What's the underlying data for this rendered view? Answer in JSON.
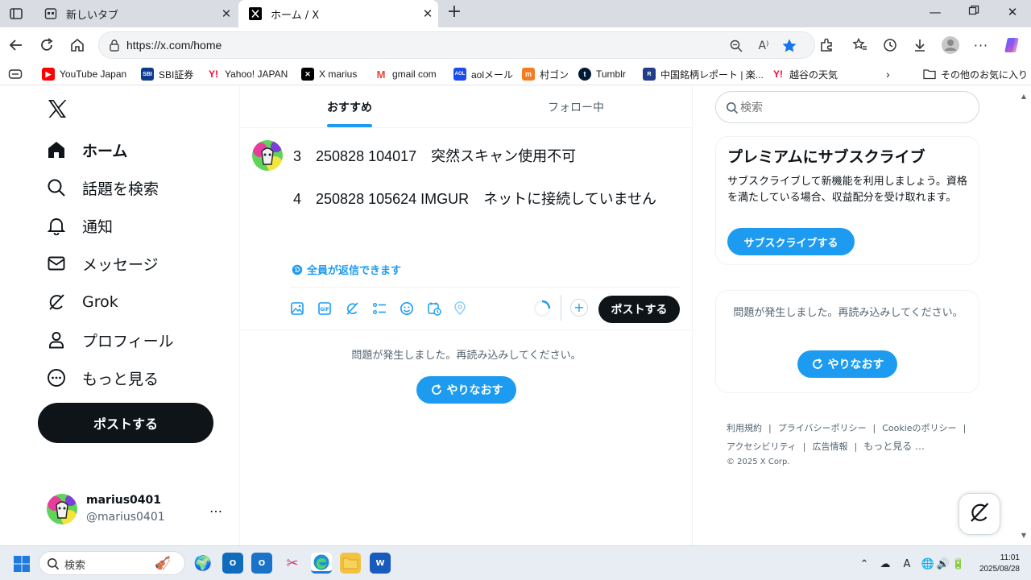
{
  "browser": {
    "tabs": [
      {
        "title": "新しいタブ",
        "icon": "new-tab-page-icon",
        "active": false
      },
      {
        "title": "ホーム / X",
        "icon": "x-logo-icon",
        "active": true
      }
    ],
    "url": "https://x.com/home",
    "bookmarks": [
      {
        "label": "YouTube Japan",
        "icon": "youtube-icon",
        "color": "#ff0000"
      },
      {
        "label": "SBI証券",
        "icon": "sbi-icon",
        "color": "#0b3a8f"
      },
      {
        "label": "Yahoo! JAPAN",
        "icon": "yahoo-icon",
        "color": "#ff0033"
      },
      {
        "label": "X marius",
        "icon": "x-logo-icon",
        "color": "#000000"
      },
      {
        "label": "gmail com",
        "icon": "gmail-icon",
        "color": "#ea4335"
      },
      {
        "label": "aolメール",
        "icon": "aol-icon",
        "color": "#1a4cf0"
      },
      {
        "label": "村ゴン",
        "icon": "murago-icon",
        "color": "#f47b20"
      },
      {
        "label": "Tumblr",
        "icon": "tumblr-icon",
        "color": "#001935"
      },
      {
        "label": "中国銘柄レポート | 楽...",
        "icon": "rakuten-icon",
        "color": "#1f3f8a"
      },
      {
        "label": "越谷の天気",
        "icon": "yahoo-icon",
        "color": "#ff0033"
      }
    ],
    "other_favorites": "その他のお気に入り"
  },
  "x": {
    "nav": [
      {
        "label": "ホーム",
        "icon": "home-icon",
        "active": true
      },
      {
        "label": "話題を検索",
        "icon": "search-icon",
        "active": false
      },
      {
        "label": "通知",
        "icon": "bell-icon",
        "active": false
      },
      {
        "label": "メッセージ",
        "icon": "mail-icon",
        "active": false
      },
      {
        "label": "Grok",
        "icon": "grok-icon",
        "active": false
      },
      {
        "label": "プロフィール",
        "icon": "person-icon",
        "active": false
      },
      {
        "label": "もっと見る",
        "icon": "more-circle-icon",
        "active": false
      }
    ],
    "post_button": "ポストする",
    "account": {
      "name": "marius0401",
      "handle": "@marius0401",
      "more": "…"
    },
    "tabs": {
      "recommended": "おすすめ",
      "following": "フォロー中"
    },
    "composer": {
      "line1": "3　250828 104017　突然スキャン使用不可",
      "line2": "4　250828 105624 IMGUR　ネットに接続していません",
      "reply_setting": "全員が返信できます",
      "plus": "+",
      "post": "ポストする"
    },
    "feed_error": {
      "message": "問題が発生しました。再読み込みしてください。",
      "retry": "やりなおす"
    },
    "search_placeholder": "検索",
    "premium": {
      "title": "プレミアムにサブスクライブ",
      "body": "サブスクライブして新機能を利用しましょう。資格を満たしている場合、収益配分を受け取れます。",
      "button": "サブスクライブする"
    },
    "sidebar_error": {
      "message": "問題が発生しました。再読み込みしてください。",
      "retry": "やりなおす"
    },
    "footer": {
      "terms": "利用規約",
      "privacy": "プライバシーポリシー",
      "cookie": "Cookieのポリシー",
      "accessibility": "アクセシビリティ",
      "ads": "広告情報",
      "more": "もっと見る …",
      "copyright": "© 2025 X Corp."
    },
    "accent_color": "#1d9bf0"
  },
  "taskbar": {
    "search": "検索",
    "time": "11:01",
    "date": "2025/08/28",
    "ime": "A"
  }
}
